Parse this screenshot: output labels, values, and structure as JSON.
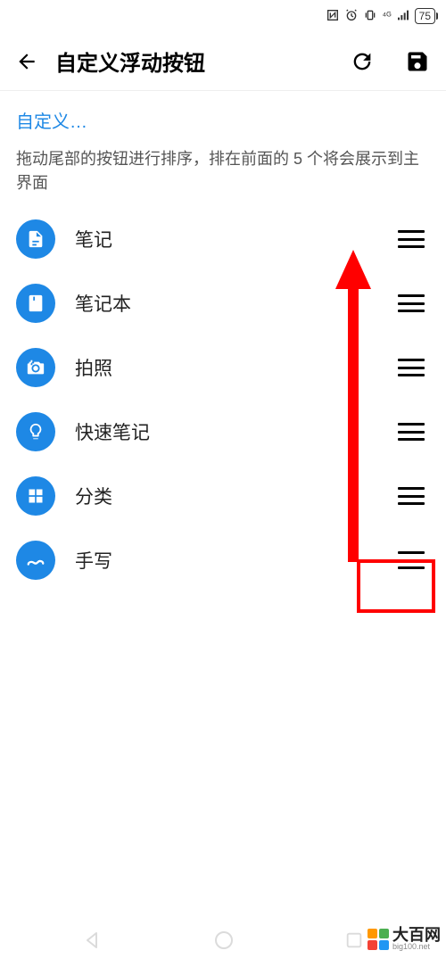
{
  "status": {
    "battery": "75"
  },
  "appbar": {
    "title": "自定义浮动按钮"
  },
  "content": {
    "custom_link": "自定义…",
    "hint": "拖动尾部的按钮进行排序，排在前面的 5 个将会展示到主界面"
  },
  "list": {
    "items": [
      {
        "label": "笔记"
      },
      {
        "label": "笔记本"
      },
      {
        "label": "拍照"
      },
      {
        "label": "快速笔记"
      },
      {
        "label": "分类"
      },
      {
        "label": "手写"
      }
    ]
  },
  "watermark": {
    "main": "大百网",
    "sub": "big100.net"
  }
}
